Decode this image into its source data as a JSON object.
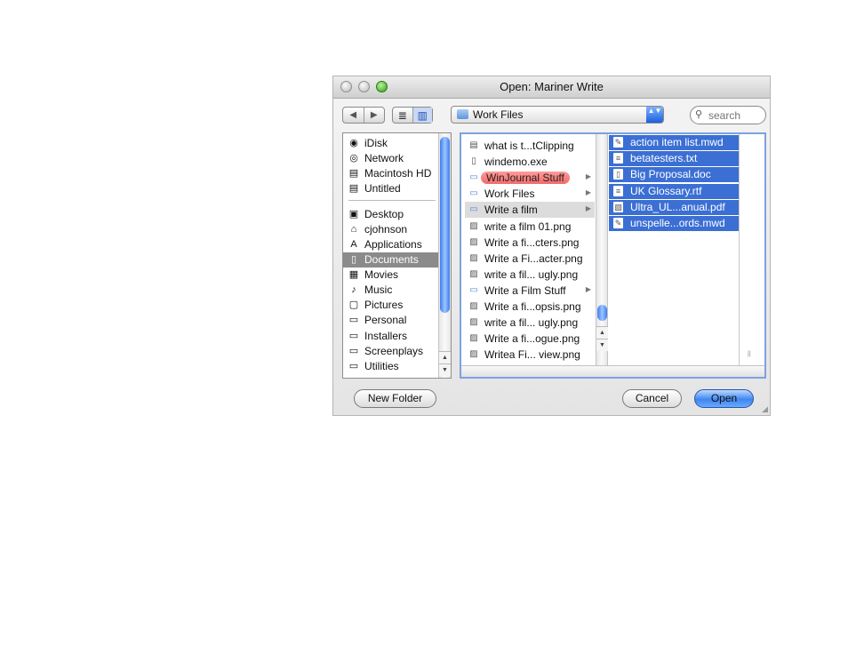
{
  "window": {
    "title": "Open: Mariner Write"
  },
  "toolbar": {
    "back_glyph": "◀",
    "forward_glyph": "▶",
    "list_view_glyph": "≣",
    "column_view_glyph": "▥",
    "location": "Work Files",
    "location_arrows": "▲▼",
    "search_placeholder": "search"
  },
  "sidebar": {
    "items": [
      {
        "label": "iDisk",
        "icon": "idisk-icon",
        "glyph": "◉"
      },
      {
        "label": "Network",
        "icon": "network-globe-icon",
        "glyph": "◎"
      },
      {
        "label": "Macintosh HD",
        "icon": "hard-disk-icon",
        "glyph": "▤"
      },
      {
        "label": "Untitled",
        "icon": "hard-disk-icon",
        "glyph": "▤"
      },
      {
        "label": "Desktop",
        "icon": "desktop-icon",
        "glyph": "▣"
      },
      {
        "label": "cjohnson",
        "icon": "home-icon",
        "glyph": "⌂"
      },
      {
        "label": "Applications",
        "icon": "applications-icon",
        "glyph": "A"
      },
      {
        "label": "Documents",
        "icon": "documents-icon",
        "glyph": "▯",
        "selected": true
      },
      {
        "label": "Movies",
        "icon": "movies-icon",
        "glyph": "▦"
      },
      {
        "label": "Music",
        "icon": "music-icon",
        "glyph": "♪"
      },
      {
        "label": "Pictures",
        "icon": "pictures-icon",
        "glyph": "▢"
      },
      {
        "label": "Personal",
        "icon": "folder-icon",
        "glyph": "▭"
      },
      {
        "label": "Installers",
        "icon": "folder-icon",
        "glyph": "▭"
      },
      {
        "label": "Screenplays",
        "icon": "folder-icon",
        "glyph": "▭"
      },
      {
        "label": "Utilities",
        "icon": "folder-icon",
        "glyph": "▭"
      }
    ]
  },
  "column2": {
    "items": [
      {
        "label": "what is t...tClipping",
        "icon": "clipping-file-icon",
        "glyph": "▤"
      },
      {
        "label": "windemo.exe",
        "icon": "document-icon",
        "glyph": "▯"
      },
      {
        "label": "WinJournal Stuff",
        "icon": "folder-icon",
        "glyph": "▭",
        "folder": true,
        "red_label": true
      },
      {
        "label": "Work Files",
        "icon": "folder-icon",
        "glyph": "▭",
        "folder": true
      },
      {
        "label": "Write a film",
        "icon": "folder-icon",
        "glyph": "▭",
        "folder": true,
        "highlighted": true
      },
      {
        "label": "write a film 01.png",
        "icon": "image-file-icon",
        "glyph": "▨"
      },
      {
        "label": "Write a fi...cters.png",
        "icon": "image-file-icon",
        "glyph": "▨"
      },
      {
        "label": "Write a Fi...acter.png",
        "icon": "image-file-icon",
        "glyph": "▨"
      },
      {
        "label": "write a fil... ugly.png",
        "icon": "image-file-icon",
        "glyph": "▨"
      },
      {
        "label": "Write a Film Stuff",
        "icon": "folder-icon",
        "glyph": "▭",
        "folder": true
      },
      {
        "label": "Write a fi...opsis.png",
        "icon": "image-file-icon",
        "glyph": "▨"
      },
      {
        "label": "write a fil... ugly.png",
        "icon": "image-file-icon",
        "glyph": "▨"
      },
      {
        "label": "Write a fi...ogue.png",
        "icon": "image-file-icon",
        "glyph": "▨"
      },
      {
        "label": "Writea  Fi... view.png",
        "icon": "image-file-icon",
        "glyph": "▨"
      }
    ],
    "submenu_arrow": "▶"
  },
  "column3": {
    "items": [
      {
        "label": "action item list.mwd",
        "icon": "mariner-doc-icon",
        "glyph": "✎"
      },
      {
        "label": "betatesters.txt",
        "icon": "text-file-icon",
        "glyph": "≡"
      },
      {
        "label": "Big Proposal.doc",
        "icon": "document-icon",
        "glyph": "▯"
      },
      {
        "label": "UK Glossary.rtf",
        "icon": "rtf-file-icon",
        "glyph": "≡"
      },
      {
        "label": "Ultra_UL...anual.pdf",
        "icon": "pdf-file-icon",
        "glyph": "▨"
      },
      {
        "label": "unspelle...ords.mwd",
        "icon": "mariner-doc-icon",
        "glyph": "✎"
      }
    ]
  },
  "buttons": {
    "new_folder": "New Folder",
    "cancel": "Cancel",
    "open": "Open"
  },
  "colors": {
    "selection_blue": "#3b6fd4",
    "sidebar_selected": "#8b8b8b",
    "red_label": "#f26a6a",
    "default_button": "#3e86f0"
  }
}
